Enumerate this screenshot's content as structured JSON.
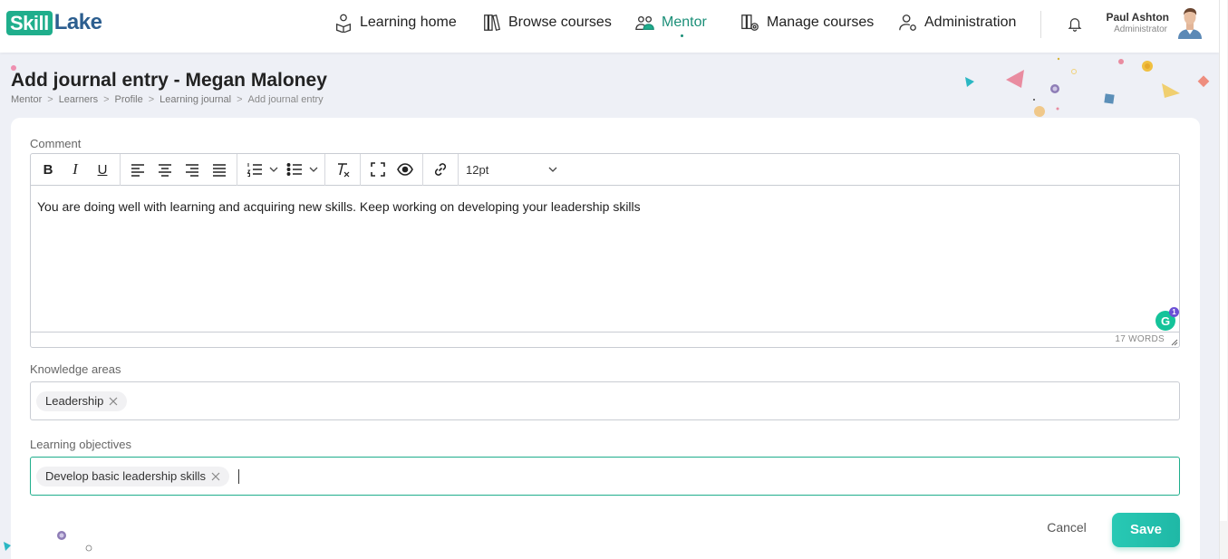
{
  "brand": {
    "part1": "Skill",
    "part2": "Lake",
    "accent": "#1fae8c",
    "dark": "#2c5e8f"
  },
  "nav": [
    {
      "label": "Learning home",
      "icon": "learning-home-icon",
      "active": false
    },
    {
      "label": "Browse courses",
      "icon": "books-icon",
      "active": false
    },
    {
      "label": "Mentor",
      "icon": "mentor-icon",
      "active": true
    },
    {
      "label": "Manage courses",
      "icon": "manage-courses-icon",
      "active": false
    },
    {
      "label": "Administration",
      "icon": "admin-user-icon",
      "active": false
    }
  ],
  "user": {
    "name": "Paul Ashton",
    "role": "Administrator"
  },
  "page": {
    "title": "Add journal entry - Megan Maloney",
    "breadcrumb": [
      "Mentor",
      "Learners",
      "Profile",
      "Learning journal",
      "Add journal entry"
    ]
  },
  "form": {
    "comment_label": "Comment",
    "toolbar": {
      "bold": "B",
      "italic": "I",
      "underline": "U",
      "font_size": "12pt"
    },
    "comment_text": "You are doing well with learning and acquiring new skills. Keep working on developing your leadership skills",
    "word_count": "17 WORDS",
    "grammarly_count": "1",
    "grammarly_letter": "G",
    "knowledge_label": "Knowledge areas",
    "knowledge_tags": [
      "Leadership"
    ],
    "objectives_label": "Learning objectives",
    "objective_tags": [
      "Develop basic leadership skills"
    ],
    "cancel_label": "Cancel",
    "save_label": "Save"
  }
}
